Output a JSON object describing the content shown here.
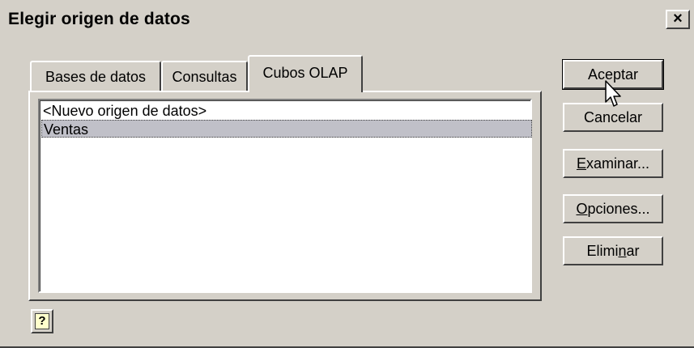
{
  "window": {
    "title": "Elegir origen de datos",
    "close_glyph": "×"
  },
  "tabs": [
    {
      "label": "Bases de datos",
      "active": false
    },
    {
      "label": "Consultas",
      "active": false
    },
    {
      "label": "Cubos OLAP",
      "active": true
    }
  ],
  "list": {
    "items": [
      {
        "label": "<Nuevo origen de datos>",
        "selected": false
      },
      {
        "label": "Ventas",
        "selected": true
      }
    ]
  },
  "buttons": {
    "aceptar": "Aceptar",
    "cancelar": "Cancelar",
    "examinar_accel": "E",
    "examinar_rest": "xaminar...",
    "opciones_accel": "O",
    "opciones_rest": "pciones...",
    "eliminar_pre": "Elimi",
    "eliminar_accel": "n",
    "eliminar_rest": "ar"
  },
  "help": {
    "glyph": "?"
  },
  "colors": {
    "face": "#d4d0c8",
    "selection": "#c0c0c8"
  },
  "icons": {
    "close": "close-icon",
    "help": "help-icon",
    "cursor": "mouse-pointer-icon"
  }
}
